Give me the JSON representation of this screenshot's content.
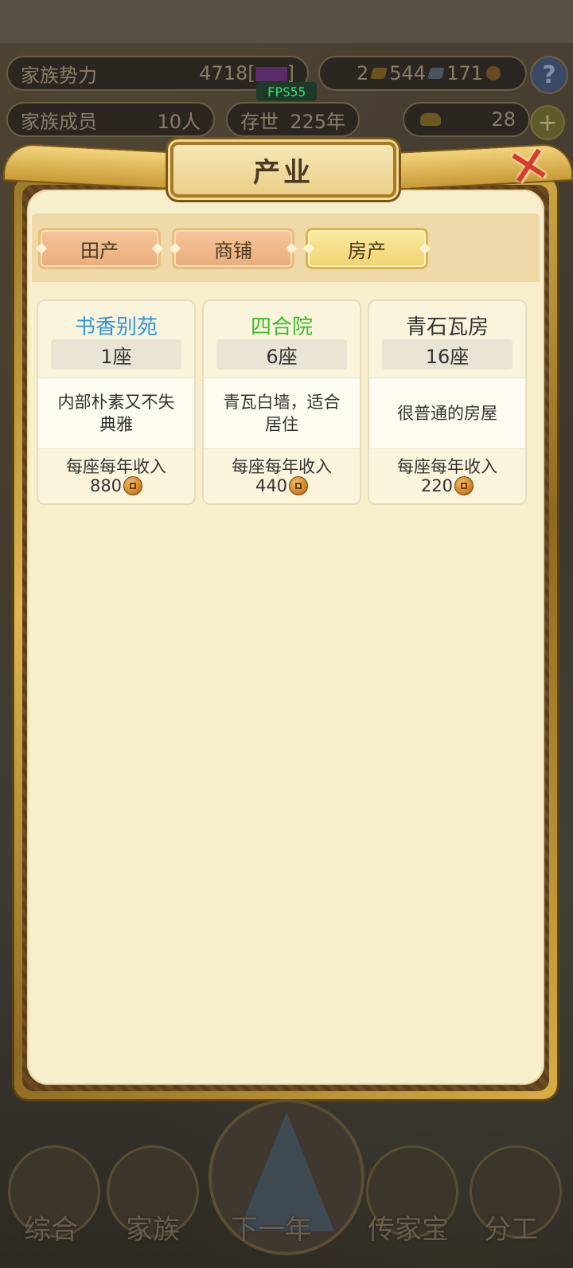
{
  "hud": {
    "family_power_label": "家族势力",
    "family_power_value": "4718",
    "power_bracket_left": "[",
    "power_bracket_right": "]",
    "gold_count": "2",
    "silver_count": "544",
    "coin_count": "171",
    "help_label": "?",
    "members_label": "家族成员",
    "members_value": "10人",
    "survival_label": "存世",
    "survival_value": "225年",
    "yuanbao_count": "28",
    "plus_label": "+"
  },
  "fps": "FPS55",
  "panel": {
    "title": "产业",
    "close_label": "✕",
    "tabs": [
      {
        "label": "田产",
        "active": false
      },
      {
        "label": "商铺",
        "active": false
      },
      {
        "label": "房产",
        "active": true
      }
    ],
    "cards": [
      {
        "name": "书香别苑",
        "name_color": "#2e97e0",
        "count": "1座",
        "desc_line1": "内部朴素又不失",
        "desc_line2": "典雅",
        "income_label": "每座每年收入",
        "income": "880"
      },
      {
        "name": "四合院",
        "name_color": "#3dbb2e",
        "count": "6座",
        "desc_line1": "青瓦白墙，适合",
        "desc_line2": "居住",
        "income_label": "每座每年收入",
        "income": "440"
      },
      {
        "name": "青石瓦房",
        "name_color": "#333333",
        "count": "16座",
        "desc_line1": "很普通的房屋",
        "desc_line2": "",
        "income_label": "每座每年收入",
        "income": "220"
      }
    ]
  },
  "bottom_nav": {
    "items": [
      "综合",
      "家族",
      "下一年",
      "传家宝",
      "分工"
    ]
  }
}
